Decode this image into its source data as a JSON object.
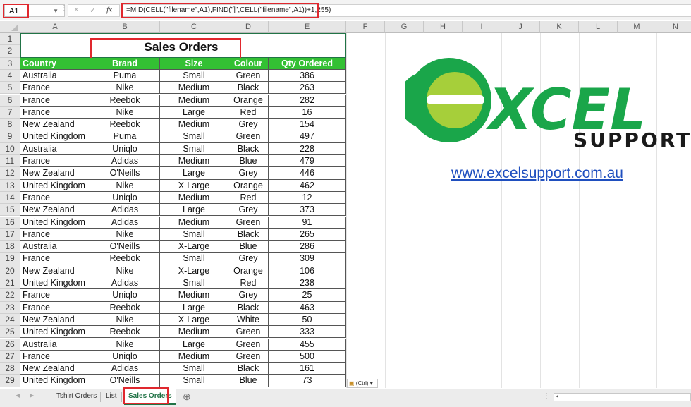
{
  "formula_bar": {
    "name_box": "A1",
    "cancel_icon": "×",
    "enter_icon": "✓",
    "fx_label": "fx",
    "formula": "=MID(CELL(\"filename\",A1),FIND(\"]\",CELL(\"filename\",A1))+1,255)"
  },
  "columns": [
    "A",
    "B",
    "C",
    "D",
    "E",
    "F",
    "G",
    "H",
    "I",
    "J",
    "K",
    "L",
    "M",
    "N"
  ],
  "sheet": {
    "title": "Sales Orders",
    "headers": [
      "Country",
      "Brand",
      "Size",
      "Colour",
      "Qty Ordered"
    ],
    "rows": [
      {
        "row": "4",
        "country": "Australia",
        "brand": "Puma",
        "size": "Small",
        "colour": "Green",
        "qty": "386"
      },
      {
        "row": "5",
        "country": "France",
        "brand": "Nike",
        "size": "Medium",
        "colour": "Black",
        "qty": "263"
      },
      {
        "row": "6",
        "country": "France",
        "brand": "Reebok",
        "size": "Medium",
        "colour": "Orange",
        "qty": "282"
      },
      {
        "row": "7",
        "country": "France",
        "brand": "Nike",
        "size": "Large",
        "colour": "Red",
        "qty": "16"
      },
      {
        "row": "8",
        "country": "New Zealand",
        "brand": "Reebok",
        "size": "Medium",
        "colour": "Grey",
        "qty": "154"
      },
      {
        "row": "9",
        "country": "United Kingdom",
        "brand": "Puma",
        "size": "Small",
        "colour": "Green",
        "qty": "497"
      },
      {
        "row": "10",
        "country": "Australia",
        "brand": "Uniqlo",
        "size": "Small",
        "colour": "Black",
        "qty": "228"
      },
      {
        "row": "11",
        "country": "France",
        "brand": "Adidas",
        "size": "Medium",
        "colour": "Blue",
        "qty": "479"
      },
      {
        "row": "12",
        "country": "New Zealand",
        "brand": "O'Neills",
        "size": "Large",
        "colour": "Grey",
        "qty": "446"
      },
      {
        "row": "13",
        "country": "United Kingdom",
        "brand": "Nike",
        "size": "X-Large",
        "colour": "Orange",
        "qty": "462"
      },
      {
        "row": "14",
        "country": "France",
        "brand": "Uniqlo",
        "size": "Medium",
        "colour": "Red",
        "qty": "12"
      },
      {
        "row": "15",
        "country": "New Zealand",
        "brand": "Adidas",
        "size": "Large",
        "colour": "Grey",
        "qty": "373"
      },
      {
        "row": "16",
        "country": "United Kingdom",
        "brand": "Adidas",
        "size": "Medium",
        "colour": "Green",
        "qty": "91"
      },
      {
        "row": "17",
        "country": "France",
        "brand": "Nike",
        "size": "Small",
        "colour": "Black",
        "qty": "265"
      },
      {
        "row": "18",
        "country": "Australia",
        "brand": "O'Neills",
        "size": "X-Large",
        "colour": "Blue",
        "qty": "286"
      },
      {
        "row": "19",
        "country": "France",
        "brand": "Reebok",
        "size": "Small",
        "colour": "Grey",
        "qty": "309"
      },
      {
        "row": "20",
        "country": "New Zealand",
        "brand": "Nike",
        "size": "X-Large",
        "colour": "Orange",
        "qty": "106"
      },
      {
        "row": "21",
        "country": "United Kingdom",
        "brand": "Adidas",
        "size": "Small",
        "colour": "Red",
        "qty": "238"
      },
      {
        "row": "22",
        "country": "France",
        "brand": "Uniqlo",
        "size": "Medium",
        "colour": "Grey",
        "qty": "25"
      },
      {
        "row": "23",
        "country": "France",
        "brand": "Reebok",
        "size": "Large",
        "colour": "Black",
        "qty": "463"
      },
      {
        "row": "24",
        "country": "New Zealand",
        "brand": "Nike",
        "size": "X-Large",
        "colour": "White",
        "qty": "50"
      },
      {
        "row": "25",
        "country": "United Kingdom",
        "brand": "Reebok",
        "size": "Medium",
        "colour": "Green",
        "qty": "333"
      },
      {
        "row": "26",
        "country": "Australia",
        "brand": "Nike",
        "size": "Large",
        "colour": "Green",
        "qty": "455"
      },
      {
        "row": "27",
        "country": "France",
        "brand": "Uniqlo",
        "size": "Medium",
        "colour": "Green",
        "qty": "500"
      },
      {
        "row": "28",
        "country": "New Zealand",
        "brand": "Adidas",
        "size": "Small",
        "colour": "Black",
        "qty": "161"
      },
      {
        "row": "29",
        "country": "United Kingdom",
        "brand": "O'Neills",
        "size": "Small",
        "colour": "Blue",
        "qty": "73"
      }
    ]
  },
  "logo": {
    "word": "XCEL",
    "subword": "SUPPORT",
    "url": "www.excelsupport.com.au",
    "colors": {
      "dark_green": "#1aa64a",
      "light_green": "#a6cf3a",
      "text_dark": "#1a1a1a"
    }
  },
  "sheet_tabs": [
    {
      "label": "Tshirt Orders",
      "active": false
    },
    {
      "label": "List",
      "active": false
    },
    {
      "label": "Sales Orders",
      "active": true
    }
  ],
  "add_sheet_icon": "⊕",
  "paste_options_label": "(Ctrl) ▾",
  "colors": {
    "header_green": "#33c033",
    "excel_green": "#217346",
    "highlight_red": "#e0282e"
  }
}
